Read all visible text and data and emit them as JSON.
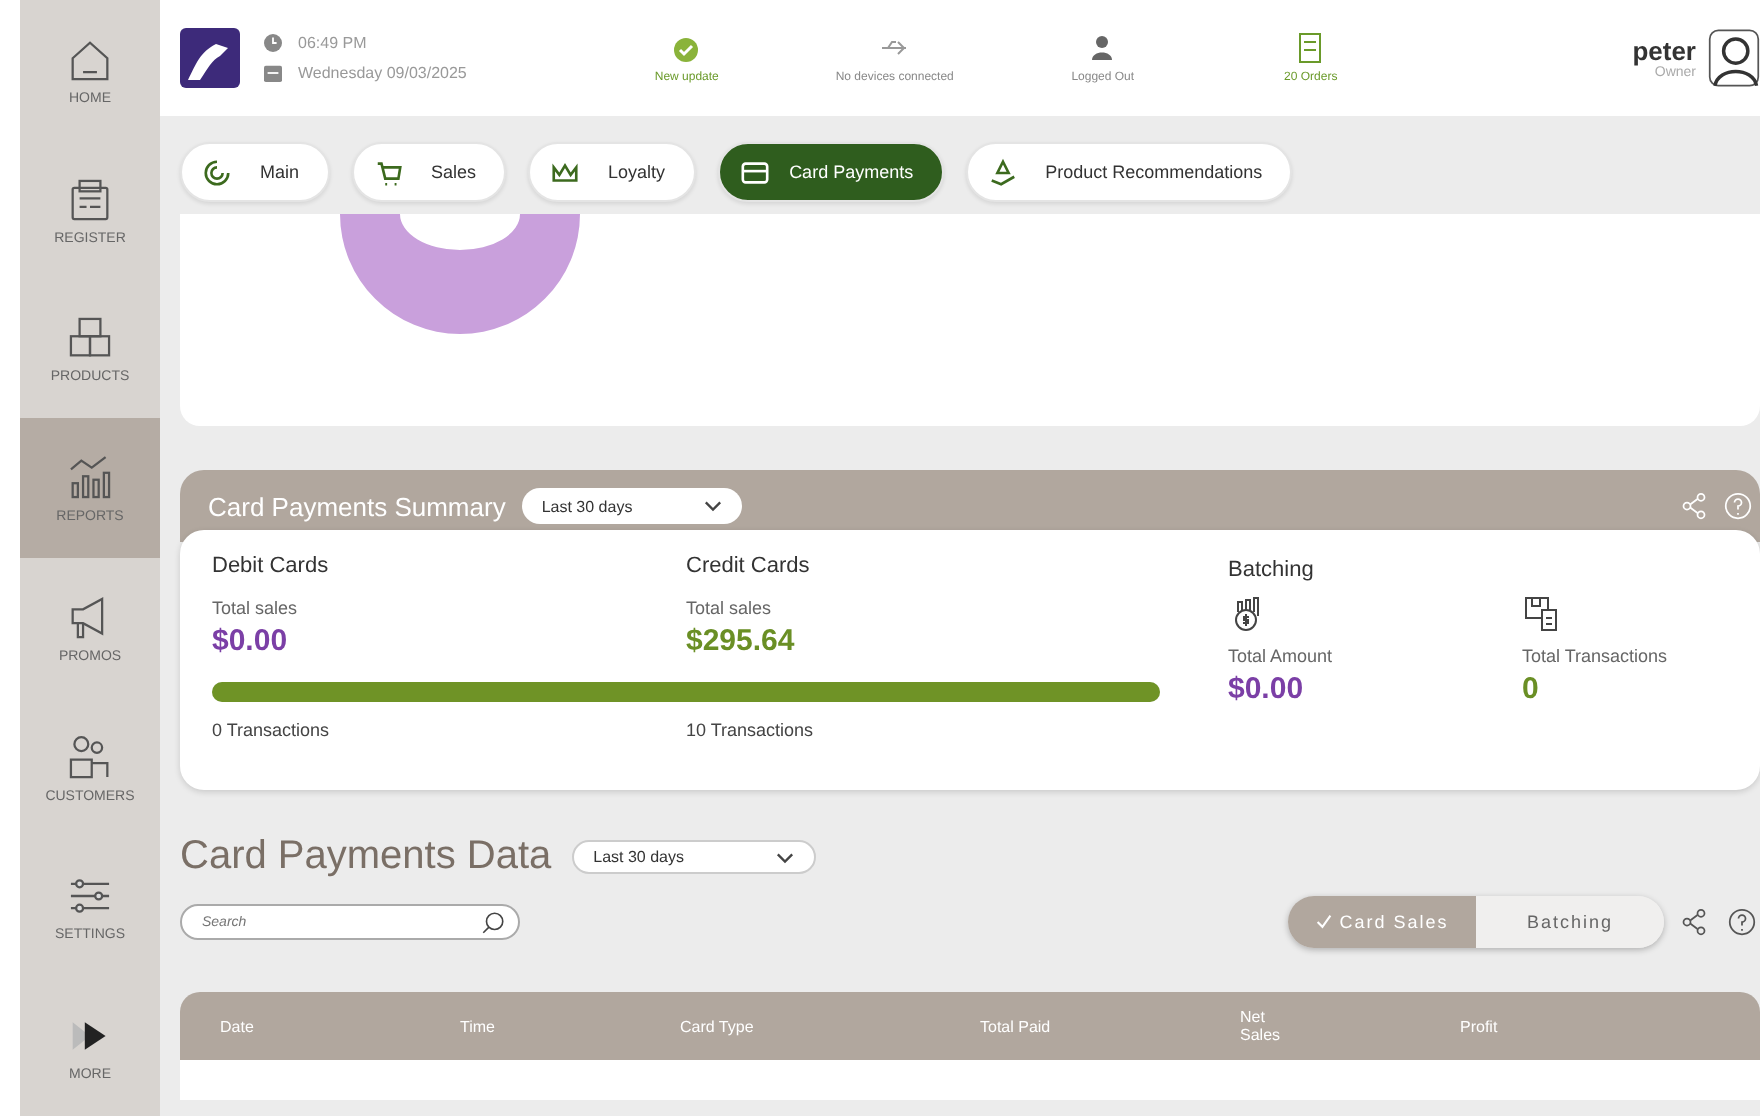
{
  "sidebar": {
    "items": [
      {
        "label": "HOME",
        "kind": "home",
        "selected": false
      },
      {
        "label": "REGISTER",
        "kind": "register",
        "selected": false
      },
      {
        "label": "PRODUCTS",
        "kind": "products",
        "selected": false
      },
      {
        "label": "REPORTS",
        "kind": "reports",
        "selected": true
      },
      {
        "label": "PROMOS",
        "kind": "promos",
        "selected": false
      },
      {
        "label": "CUSTOMERS",
        "kind": "customers",
        "selected": false
      },
      {
        "label": "SETTINGS",
        "kind": "settings",
        "selected": false
      },
      {
        "label": "MORE",
        "kind": "more",
        "selected": false
      }
    ]
  },
  "header": {
    "time": "06:49 PM",
    "date": "Wednesday 09/03/2025",
    "status": [
      {
        "kind": "update",
        "label": "New update"
      },
      {
        "kind": "devices",
        "label": "No devices connected"
      },
      {
        "kind": "user",
        "label": "Logged Out"
      },
      {
        "kind": "orders",
        "label": "20 Orders"
      }
    ],
    "user": {
      "name": "peter",
      "role": "Owner"
    }
  },
  "tabs": [
    {
      "label": "Main",
      "kind": "main",
      "selected": false
    },
    {
      "label": "Sales",
      "kind": "sales",
      "selected": false
    },
    {
      "label": "Loyalty",
      "kind": "loyalty",
      "selected": false
    },
    {
      "label": "Card Payments",
      "kind": "card",
      "selected": true
    },
    {
      "label": "Product Recommendations",
      "kind": "recommend",
      "selected": false
    }
  ],
  "summary": {
    "title": "Card Payments Summary",
    "period": "Last 30 days",
    "debit": {
      "title": "Debit Cards",
      "label": "Total sales",
      "amount": "$0.00",
      "transactions": "0 Transactions"
    },
    "credit": {
      "title": "Credit Cards",
      "label": "Total sales",
      "amount": "$295.64",
      "transactions": "10 Transactions"
    },
    "bar": {
      "level": 1
    },
    "batching": {
      "title": "Batching",
      "amount_label": "Total Amount",
      "amount": "$0.00",
      "count_label": "Total Transactions",
      "count": "0"
    }
  },
  "data": {
    "title": "Card Payments Data",
    "period": "Last 30 days",
    "search": {
      "placeholder": "Search"
    },
    "toggle": [
      {
        "label": "Card Sales",
        "selected": true
      },
      {
        "label": "Batching",
        "selected": false
      }
    ],
    "columns": [
      "Date",
      "Time",
      "Card Type",
      "Total Paid",
      "Net Sales",
      "Profit"
    ]
  }
}
